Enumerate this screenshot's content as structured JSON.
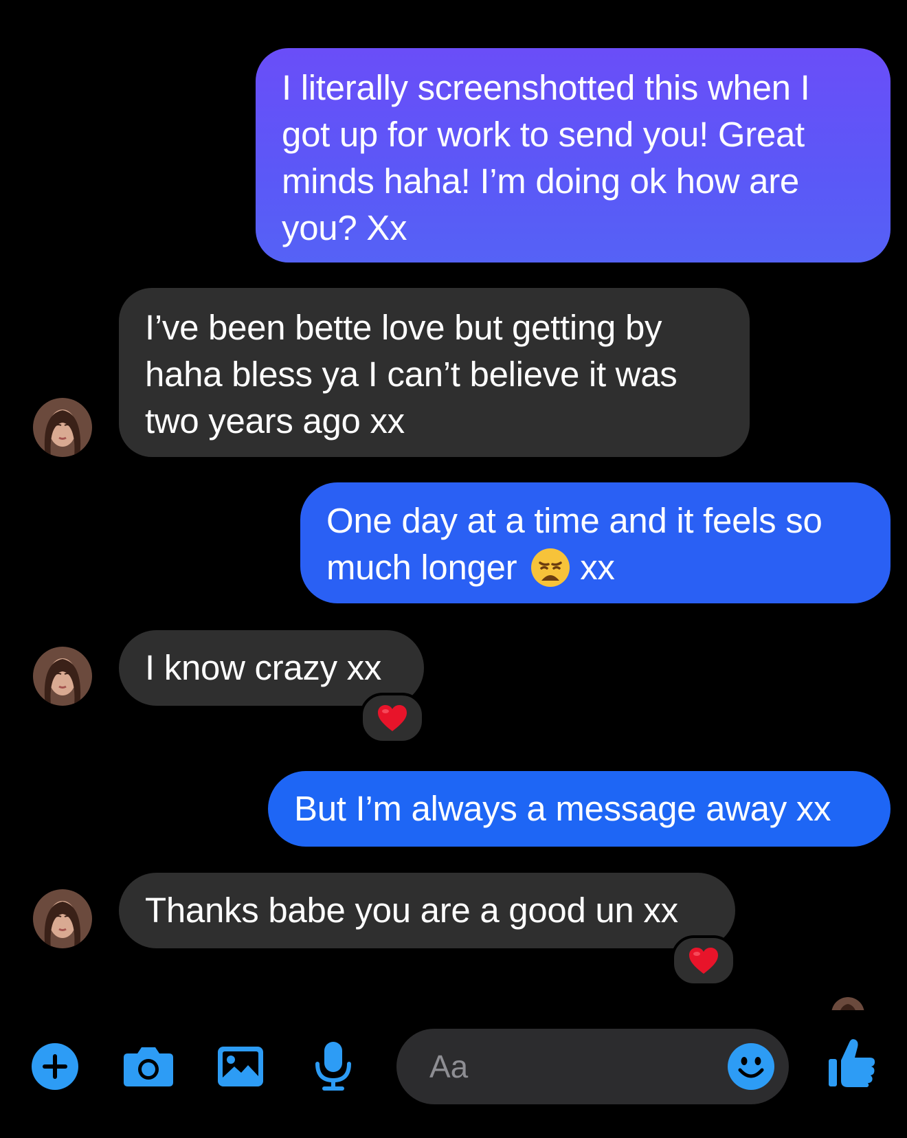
{
  "colors": {
    "background": "#000000",
    "outgoing_purple": "#5b58f7",
    "outgoing_blue": "#1e66f5",
    "incoming_bubble": "#2f2f2f",
    "accent": "#2d9cf5",
    "placeholder": "#8e8e93"
  },
  "messages": [
    {
      "direction": "outgoing",
      "lines": [
        "I literally screenshotted this when I",
        "got up for work to send you! Great",
        "minds haha! I’m doing ok how are",
        "you? Xx"
      ]
    },
    {
      "direction": "incoming",
      "lines": [
        "I’ve been bette love but getting by",
        "haha bless ya I can’t believe it was",
        "two years ago xx"
      ]
    },
    {
      "direction": "outgoing",
      "lines": [
        "One day at a time and it feels so",
        "much longer 😩 xx"
      ]
    },
    {
      "direction": "incoming",
      "lines": [
        "I know crazy xx"
      ],
      "reaction": "❤️"
    },
    {
      "direction": "outgoing",
      "lines": [
        "But I’m always a message away xx"
      ]
    },
    {
      "direction": "incoming",
      "lines": [
        "Thanks babe you are a good un xx"
      ],
      "reaction": "❤️"
    }
  ],
  "composer": {
    "placeholder": "Aa",
    "icons": [
      "plus-icon",
      "camera-icon",
      "gallery-icon",
      "microphone-icon",
      "smiley-icon",
      "thumbs-up-icon"
    ]
  }
}
